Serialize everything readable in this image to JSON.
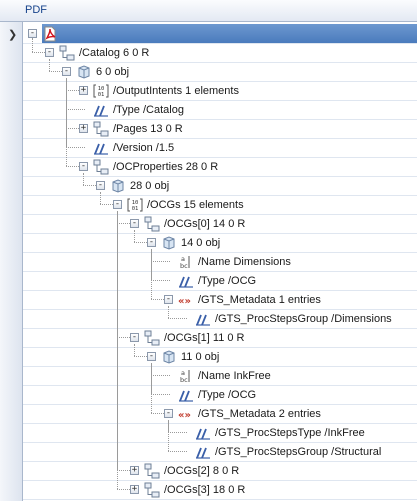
{
  "header": {
    "title": "PDF"
  },
  "root": {
    "label": ""
  },
  "tree": [
    {
      "id": "catalog",
      "label": "/Catalog 6 0 R",
      "icon": "reference-icon",
      "toggle": "-",
      "depth": 1
    },
    {
      "id": "catalog-obj",
      "label": "6 0 obj",
      "icon": "object-icon",
      "toggle": "-",
      "depth": 2
    },
    {
      "id": "outputintents",
      "label": "/OutputIntents 1 elements",
      "icon": "array-icon",
      "toggle": "+",
      "depth": 3
    },
    {
      "id": "type-catalog",
      "label": "/Type /Catalog",
      "icon": "name-icon",
      "toggle": "",
      "depth": 3
    },
    {
      "id": "pages",
      "label": "/Pages 13 0 R",
      "icon": "reference-icon",
      "toggle": "+",
      "depth": 3
    },
    {
      "id": "version",
      "label": "/Version /1.5",
      "icon": "name-icon",
      "toggle": "",
      "depth": 3
    },
    {
      "id": "ocproperties",
      "label": "/OCProperties 28 0 R",
      "icon": "reference-icon",
      "toggle": "-",
      "depth": 3
    },
    {
      "id": "ocproperties-obj",
      "label": "28 0 obj",
      "icon": "object-icon",
      "toggle": "-",
      "depth": 4
    },
    {
      "id": "ocgs",
      "label": "/OCGs 15 elements",
      "icon": "array-icon",
      "toggle": "-",
      "depth": 5
    },
    {
      "id": "ocg0",
      "label": "/OCGs[0] 14 0 R",
      "icon": "reference-icon",
      "toggle": "-",
      "depth": 6
    },
    {
      "id": "ocg0-obj",
      "label": "14 0 obj",
      "icon": "object-icon",
      "toggle": "-",
      "depth": 7
    },
    {
      "id": "ocg0-name",
      "label": "/Name Dimensions",
      "icon": "string-icon",
      "toggle": "",
      "depth": 8
    },
    {
      "id": "ocg0-type",
      "label": "/Type /OCG",
      "icon": "name-icon",
      "toggle": "",
      "depth": 8
    },
    {
      "id": "ocg0-gts",
      "label": "/GTS_Metadata 1 entries",
      "icon": "dictionary-icon",
      "toggle": "-",
      "depth": 8
    },
    {
      "id": "ocg0-gts-1",
      "label": "/GTS_ProcStepsGroup /Dimensions",
      "icon": "name-icon",
      "toggle": "",
      "depth": 9
    },
    {
      "id": "ocg1",
      "label": "/OCGs[1] 11 0 R",
      "icon": "reference-icon",
      "toggle": "-",
      "depth": 6
    },
    {
      "id": "ocg1-obj",
      "label": "11 0 obj",
      "icon": "object-icon",
      "toggle": "-",
      "depth": 7
    },
    {
      "id": "ocg1-name",
      "label": "/Name InkFree",
      "icon": "string-icon",
      "toggle": "",
      "depth": 8
    },
    {
      "id": "ocg1-type",
      "label": "/Type /OCG",
      "icon": "name-icon",
      "toggle": "",
      "depth": 8
    },
    {
      "id": "ocg1-gts",
      "label": "/GTS_Metadata 2 entries",
      "icon": "dictionary-icon",
      "toggle": "-",
      "depth": 8
    },
    {
      "id": "ocg1-gts-1",
      "label": "/GTS_ProcStepsType /InkFree",
      "icon": "name-icon",
      "toggle": "",
      "depth": 9
    },
    {
      "id": "ocg1-gts-2",
      "label": "/GTS_ProcStepsGroup /Structural",
      "icon": "name-icon",
      "toggle": "",
      "depth": 9
    },
    {
      "id": "ocg2",
      "label": "/OCGs[2] 8 0 R",
      "icon": "reference-icon",
      "toggle": "+",
      "depth": 6
    },
    {
      "id": "ocg3",
      "label": "/OCGs[3] 18 0 R",
      "icon": "reference-icon",
      "toggle": "+",
      "depth": 6
    }
  ]
}
